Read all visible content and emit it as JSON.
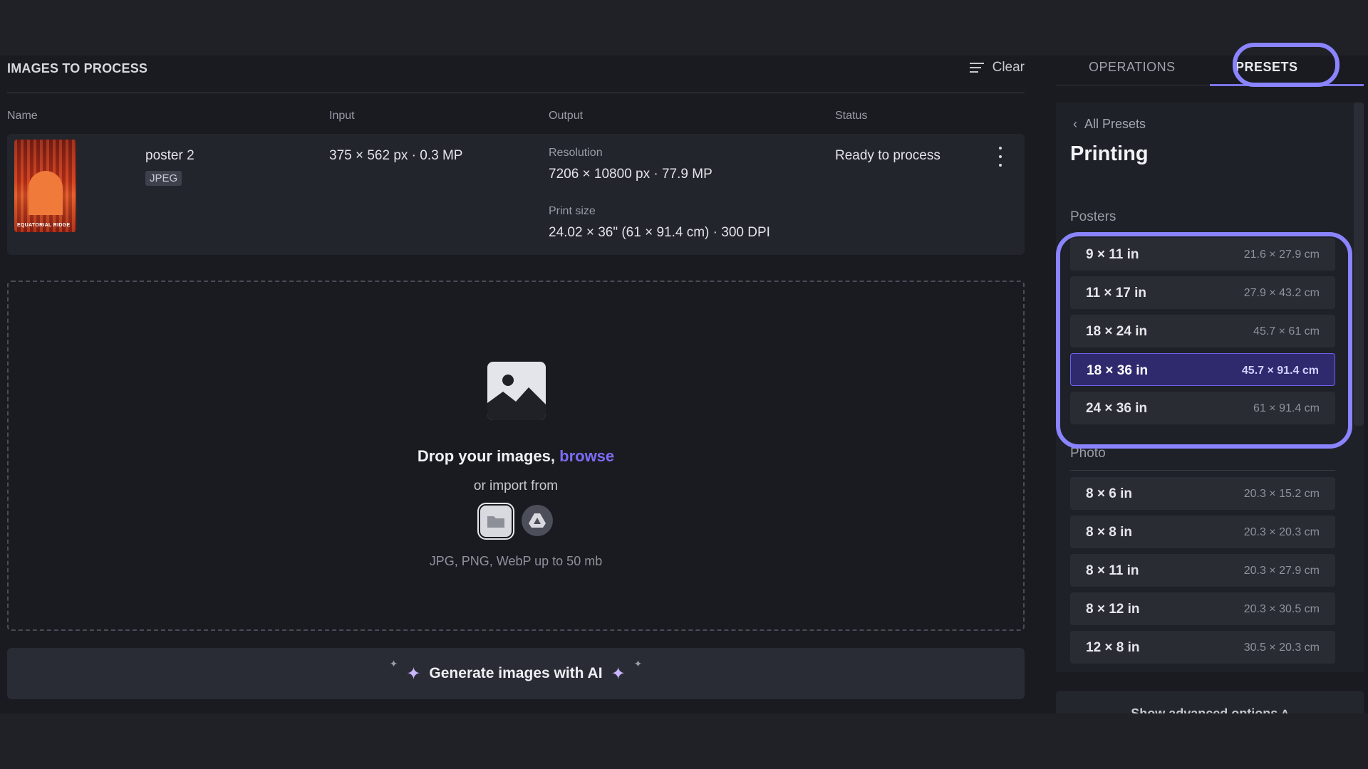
{
  "images": {
    "section_title": "IMAGES TO PROCESS",
    "clear_label": "Clear",
    "columns": {
      "name": "Name",
      "input": "Input",
      "output": "Output",
      "status": "Status"
    },
    "rows": [
      {
        "thumb_caption": "EQUATORIAL RIDGE",
        "name": "poster 2",
        "format": "JPEG",
        "input": "375 × 562 px · 0.3 MP",
        "resolution_label": "Resolution",
        "resolution": "7206 × 10800 px · 77.9 MP",
        "print_size_label": "Print size",
        "print_size": "24.02 × 36\" (61 × 91.4 cm) · 300 DPI",
        "status": "Ready to process"
      }
    ]
  },
  "dropzone": {
    "title_prefix": "Drop your images,",
    "browse": "browse",
    "subtitle": "or import from",
    "hint": "JPG, PNG, WebP up to 50 mb",
    "import_sources": [
      "device-icon",
      "google-drive-icon"
    ]
  },
  "generate": {
    "label": "Generate images with AI"
  },
  "right_panel": {
    "tabs": [
      {
        "label": "OPERATIONS",
        "active": false
      },
      {
        "label": "PRESETS",
        "active": true
      }
    ],
    "back_label": "All Presets",
    "title": "Printing",
    "groups": [
      {
        "label": "Posters",
        "items": [
          {
            "name": "9 × 11 in",
            "dim": "21.6 × 27.9 cm"
          },
          {
            "name": "11 × 17 in",
            "dim": "27.9 × 43.2 cm"
          },
          {
            "name": "18 × 24 in",
            "dim": "45.7 × 61 cm"
          },
          {
            "name": "18 × 36 in",
            "dim": "45.7 × 91.4 cm",
            "selected": true
          },
          {
            "name": "24 × 36 in",
            "dim": "61 × 91.4 cm"
          }
        ]
      },
      {
        "label": "Photo",
        "items": [
          {
            "name": "8 × 6 in",
            "dim": "20.3 × 15.2 cm"
          },
          {
            "name": "8 × 8 in",
            "dim": "20.3 × 20.3 cm"
          },
          {
            "name": "8 × 11 in",
            "dim": "20.3 × 27.9 cm"
          },
          {
            "name": "8 × 12 in",
            "dim": "20.3 × 30.5 cm"
          },
          {
            "name": "12 × 8 in",
            "dim": "30.5 × 20.3 cm"
          }
        ]
      }
    ],
    "advanced_label": "Show advanced options"
  },
  "colors": {
    "accent": "#7c6cf5",
    "highlight": "#8a84ff",
    "selected_bg": "#2f2a6e"
  }
}
